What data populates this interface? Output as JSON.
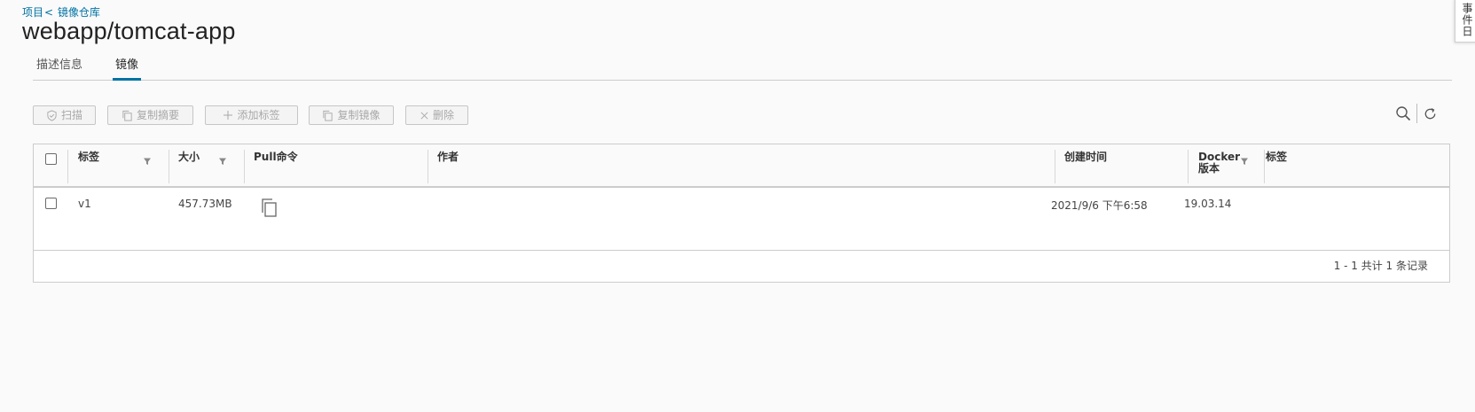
{
  "breadcrumb": {
    "project": "项目",
    "separator": "<",
    "repositories": "镜像仓库"
  },
  "title": "webapp/tomcat-app",
  "tabs": [
    {
      "label": "描述信息",
      "active": false
    },
    {
      "label": "镜像",
      "active": true
    }
  ],
  "toolbar": {
    "scan": "扫描",
    "copy_digest": "复制摘要",
    "add_label": "添加标签",
    "copy_image": "复制镜像",
    "delete": "删除"
  },
  "table": {
    "headers": {
      "tag": "标签",
      "size": "大小",
      "pull": "Pull命令",
      "author": "作者",
      "created": "创建时间",
      "docker_line1": "Docker",
      "docker_line2": "版本",
      "labels": "标签"
    },
    "rows": [
      {
        "tag": "v1",
        "size": "457.73MB",
        "author": "",
        "created": "2021/9/6 下午6:58",
        "docker_version": "19.03.14",
        "labels": ""
      }
    ],
    "footer": "1 - 1 共计 1 条记录"
  },
  "side_panel": {
    "label": "事件日"
  },
  "colors": {
    "accent": "#0072a3",
    "background": "#fafafa",
    "border": "#cccccc",
    "disabled_text": "#a8a8a8"
  },
  "icons": {
    "scan": "shield-check-icon",
    "copy_digest": "copy-icon",
    "add_label": "plus-icon",
    "copy_image": "copy-icon",
    "delete": "close-icon",
    "search": "search-icon",
    "refresh": "refresh-icon",
    "filter": "filter-icon",
    "pull_copy": "copy-icon"
  }
}
